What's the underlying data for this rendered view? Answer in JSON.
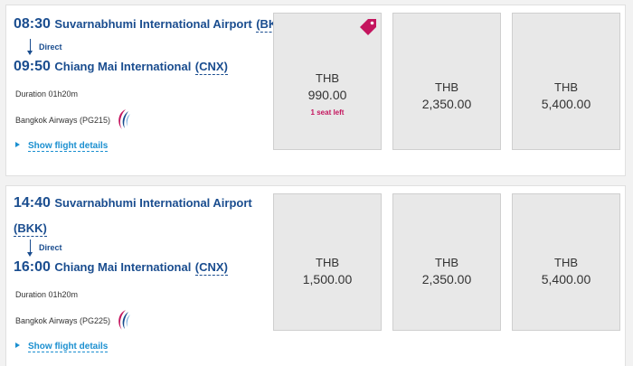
{
  "flights": [
    {
      "departure": {
        "time": "08:30",
        "airport": "Suvarnabhumi International Airport",
        "code": "(BKK)"
      },
      "stop_type": "Direct",
      "arrival": {
        "time": "09:50",
        "airport": "Chiang Mai International",
        "code": "(CNX)"
      },
      "duration": "Duration 01h20m",
      "airline": "Bangkok Airways (PG215)",
      "details_label": "Show flight details",
      "fares": [
        {
          "currency": "THB",
          "amount": "990.00",
          "note": "1 seat left",
          "promo_tag": true
        },
        {
          "currency": "THB",
          "amount": "2,350.00"
        },
        {
          "currency": "THB",
          "amount": "5,400.00"
        }
      ]
    },
    {
      "departure": {
        "time": "14:40",
        "airport": "Suvarnabhumi International Airport",
        "code": "(BKK)"
      },
      "stop_type": "Direct",
      "arrival": {
        "time": "16:00",
        "airport": "Chiang Mai International",
        "code": "(CNX)"
      },
      "duration": "Duration 01h20m",
      "airline": "Bangkok Airways (PG225)",
      "details_label": "Show flight details",
      "fares": [
        {
          "currency": "THB",
          "amount": "1,500.00"
        },
        {
          "currency": "THB",
          "amount": "2,350.00"
        },
        {
          "currency": "THB",
          "amount": "5,400.00"
        }
      ]
    }
  ],
  "icons": {
    "airline_logo": "bangkok-airways-logo",
    "promo": "price-tag-icon",
    "expand": "triangle-right-icon"
  },
  "colors": {
    "link_blue": "#1a8fd0",
    "text_navy": "#1a4d8f",
    "promo_magenta": "#c4155e",
    "fare_bg": "#e8e8e8"
  }
}
